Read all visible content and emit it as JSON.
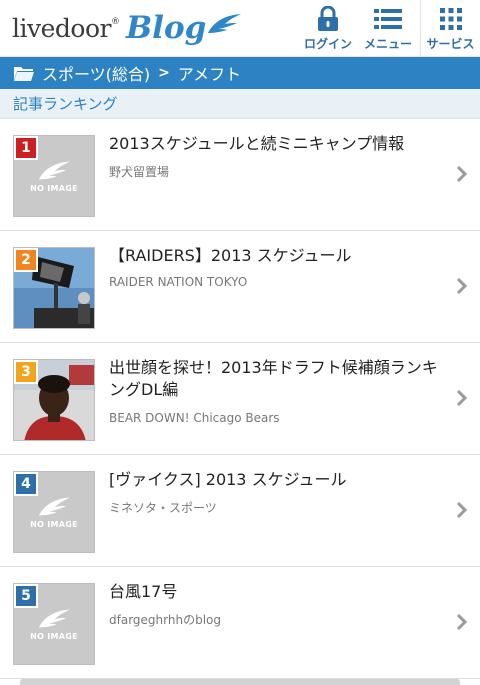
{
  "header": {
    "logo_text": "livedoor",
    "logo_mark": "®",
    "logo_blog": "Blog",
    "login_label": "ログイン",
    "menu_label": "メニュー",
    "service_label": "サービス"
  },
  "breadcrumb": {
    "category": "スポーツ(総合)",
    "separator": ">",
    "current": "アメフト"
  },
  "section": {
    "title": "記事ランキング"
  },
  "ranking": [
    {
      "rank": "1",
      "title": "2013スケジュールと続ミニキャンプ情報",
      "blog": "野犬留置場",
      "badge_color": "#cc1f1f",
      "noimage": true,
      "noimage_text": "NO IMAGE"
    },
    {
      "rank": "2",
      "title": "【RAIDERS】2013 スケジュール",
      "blog": "RAIDER NATION TOKYO",
      "badge_color": "#f0861d",
      "noimage": false
    },
    {
      "rank": "3",
      "title": "出世顔を探せ！2013年ドラフト候補顔ランキングDL編",
      "blog": "BEAR DOWN! Chicago Bears",
      "badge_color": "#f2a51a",
      "noimage": false
    },
    {
      "rank": "4",
      "title": "[ヴァイクス] 2013 スケジュール",
      "blog": "ミネソタ・スポーツ",
      "badge_color": "#2f6fa8",
      "noimage": true,
      "noimage_text": "NO IMAGE"
    },
    {
      "rank": "5",
      "title": "台風17号",
      "blog": "dfargeghrhhのblog",
      "badge_color": "#2f6fa8",
      "noimage": true,
      "noimage_text": "NO IMAGE"
    }
  ],
  "colors": {
    "accent": "#2c82c2",
    "header_label": "#2f6fa8",
    "section_bg": "#eaf1f6"
  }
}
